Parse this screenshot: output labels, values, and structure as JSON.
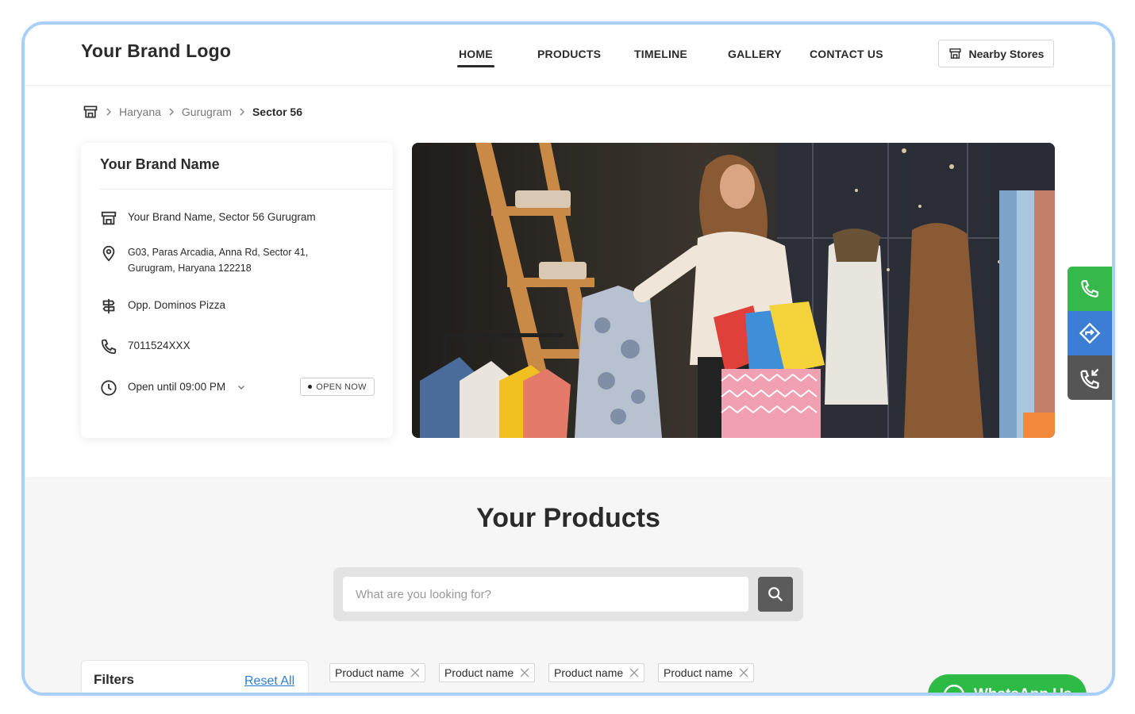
{
  "header": {
    "logo": "Your Brand Logo",
    "nav": [
      {
        "label": "HOME",
        "active": true
      },
      {
        "label": "PRODUCTS",
        "active": false
      },
      {
        "label": "TIMELINE",
        "active": false
      },
      {
        "label": "GALLERY",
        "active": false
      },
      {
        "label": "CONTACT US",
        "active": false
      }
    ],
    "nearby_label": "Nearby Stores"
  },
  "breadcrumb": {
    "items": [
      "Haryana",
      "Gurugram"
    ],
    "current": "Sector 56"
  },
  "store": {
    "name": "Your Brand Name",
    "branch": "Your Brand Name, Sector 56 Gurugram",
    "address_line1": "G03, Paras Arcadia, Anna Rd, Sector 41,",
    "address_line2": "Gurugram, Haryana 122218",
    "landmark": "Opp. Dominos Pizza",
    "phone": "7011524XXX",
    "hours": "Open until 09:00 PM",
    "status": "OPEN NOW"
  },
  "side_actions": [
    {
      "icon": "phone-icon",
      "color": "#35b94a"
    },
    {
      "icon": "directions-icon",
      "color": "#3a7fd5"
    },
    {
      "icon": "missed-call-icon",
      "color": "#555555"
    }
  ],
  "products": {
    "title": "Your Products",
    "search_placeholder": "What are you looking for?",
    "filters_title": "Filters",
    "reset_label": "Reset All",
    "chips": [
      "Product name",
      "Product name",
      "Product name",
      "Product name"
    ],
    "whatsapp_label": "WhatsApp Us"
  },
  "colors": {
    "frame_border": "#a9cffb",
    "link": "#2d7fd3",
    "whatsapp": "#2dbb45"
  }
}
